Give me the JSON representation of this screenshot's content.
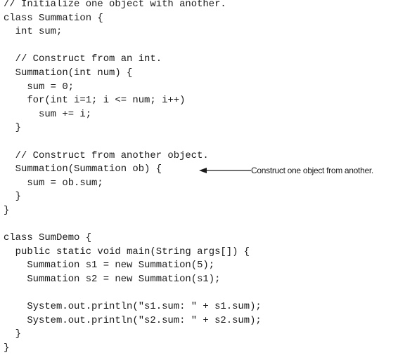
{
  "code": {
    "lines": [
      "// Initialize one object with another.",
      "class Summation {",
      "  int sum;",
      "",
      "  // Construct from an int.",
      "  Summation(int num) {",
      "    sum = 0;",
      "    for(int i=1; i <= num; i++)",
      "      sum += i;",
      "  }",
      "",
      "  // Construct from another object.",
      "  Summation(Summation ob) {",
      "    sum = ob.sum;",
      "  }",
      "}",
      "",
      "class SumDemo {",
      "  public static void main(String args[]) {",
      "    Summation s1 = new Summation(5);",
      "    Summation s2 = new Summation(s1);",
      "",
      "    System.out.println(\"s1.sum: \" + s1.sum);",
      "    System.out.println(\"s2.sum: \" + s2.sum);",
      "  }",
      "}"
    ]
  },
  "annotation": {
    "text": "Construct one object from another."
  }
}
